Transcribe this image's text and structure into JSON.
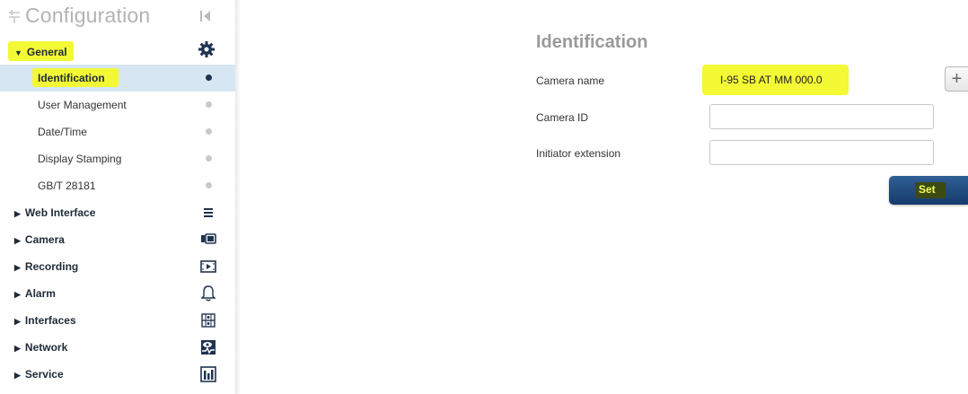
{
  "header": {
    "title": "Configuration"
  },
  "sidebar": {
    "general": {
      "label": "General"
    },
    "sub_items": [
      {
        "label": "Identification",
        "selected": true
      },
      {
        "label": "User Management"
      },
      {
        "label": "Date/Time"
      },
      {
        "label": "Display Stamping"
      },
      {
        "label": "GB/T 28181"
      }
    ],
    "sections": [
      {
        "label": "Web Interface",
        "icon": "list-icon"
      },
      {
        "label": "Camera",
        "icon": "camera-icon"
      },
      {
        "label": "Recording",
        "icon": "recording-icon"
      },
      {
        "label": "Alarm",
        "icon": "bell-icon"
      },
      {
        "label": "Interfaces",
        "icon": "interfaces-icon"
      },
      {
        "label": "Network",
        "icon": "network-icon"
      },
      {
        "label": "Service",
        "icon": "service-icon"
      }
    ]
  },
  "main": {
    "title": "Identification",
    "fields": {
      "camera_name": {
        "label": "Camera name",
        "value": "I-95 SB AT MM 000.0"
      },
      "camera_id": {
        "label": "Camera ID",
        "value": ""
      },
      "initiator_extension": {
        "label": "Initiator extension",
        "value": ""
      }
    },
    "plus_label": "+",
    "set_label": "Set"
  },
  "colors": {
    "highlight": "#f3f935",
    "accent": "#1f3350",
    "selected_bg": "#d7e6f3",
    "button": "#1e4a80"
  }
}
